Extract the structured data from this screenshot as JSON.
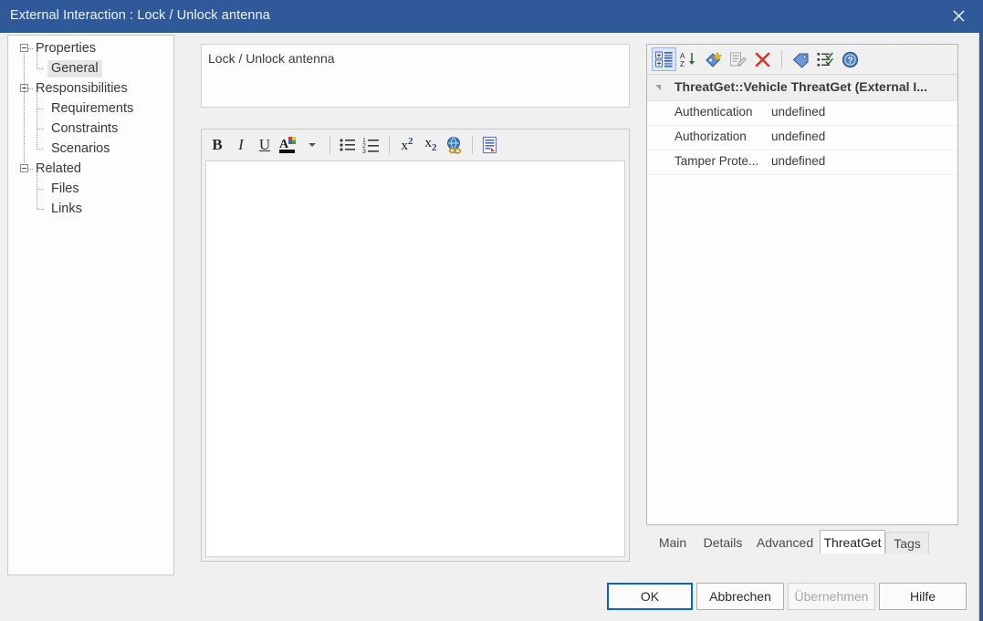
{
  "window": {
    "title": "External Interaction : Lock / Unlock antenna",
    "close_icon": "close-icon",
    "accent_color": "#2f5999"
  },
  "tree": {
    "items": [
      {
        "label": "Properties",
        "level": 0,
        "expander": "collapse-box",
        "selected": false
      },
      {
        "label": "General",
        "level": 1,
        "expander": "",
        "selected": true
      },
      {
        "label": "Responsibilities",
        "level": 0,
        "expander": "collapse-box",
        "selected": false
      },
      {
        "label": "Requirements",
        "level": 1,
        "expander": "",
        "selected": false
      },
      {
        "label": "Constraints",
        "level": 1,
        "expander": "",
        "selected": false
      },
      {
        "label": "Scenarios",
        "level": 1,
        "expander": "",
        "selected": false
      },
      {
        "label": "Related",
        "level": 0,
        "expander": "collapse-box",
        "selected": false
      },
      {
        "label": "Files",
        "level": 1,
        "expander": "",
        "selected": false
      },
      {
        "label": "Links",
        "level": 1,
        "expander": "",
        "selected": false
      }
    ]
  },
  "name_field": {
    "value": "Lock / Unlock antenna",
    "placeholder": ""
  },
  "editor": {
    "body_text": "",
    "toolbar": [
      {
        "name": "bold-icon",
        "label": "B"
      },
      {
        "name": "italic-icon",
        "label": "I"
      },
      {
        "name": "underline-icon",
        "label": "U"
      },
      {
        "name": "font-color-icon",
        "label": "A"
      },
      {
        "name": "chevron-down-icon",
        "label": ""
      },
      {
        "name": "bullet-list-icon",
        "label": ""
      },
      {
        "name": "numbered-list-icon",
        "label": ""
      },
      {
        "name": "superscript-icon",
        "label": "x"
      },
      {
        "name": "subscript-icon",
        "label": "x"
      },
      {
        "name": "hyperlink-icon",
        "label": ""
      },
      {
        "name": "insert-document-icon",
        "label": ""
      }
    ]
  },
  "properties_panel": {
    "toolbar": [
      {
        "name": "categorized-view-icon",
        "pressed": true
      },
      {
        "name": "sort-alphabetical-icon",
        "pressed": false
      },
      {
        "name": "add-property-icon",
        "pressed": false
      },
      {
        "name": "edit-property-icon",
        "pressed": false
      },
      {
        "name": "delete-property-icon",
        "pressed": false
      },
      {
        "name": "tag-icon",
        "pressed": false
      },
      {
        "name": "checklist-icon",
        "pressed": false
      },
      {
        "name": "help-icon",
        "pressed": false
      }
    ],
    "group_header": "ThreatGet::Vehicle ThreatGet (External I...",
    "rows": [
      {
        "name": "Authentication",
        "value": "undefined"
      },
      {
        "name": "Authorization",
        "value": "undefined"
      },
      {
        "name": "Tamper Prote...",
        "value": "undefined"
      }
    ]
  },
  "tabs": [
    {
      "label": "Main",
      "active": false
    },
    {
      "label": "Details",
      "active": false
    },
    {
      "label": "Advanced",
      "active": false
    },
    {
      "label": "ThreatGet",
      "active": true
    },
    {
      "label": "Tags",
      "active": false
    }
  ],
  "dialog_buttons": [
    {
      "label": "OK",
      "state": "default"
    },
    {
      "label": "Abbrechen",
      "state": "normal"
    },
    {
      "label": "Übernehmen",
      "state": "disabled"
    },
    {
      "label": "Hilfe",
      "state": "normal"
    }
  ]
}
